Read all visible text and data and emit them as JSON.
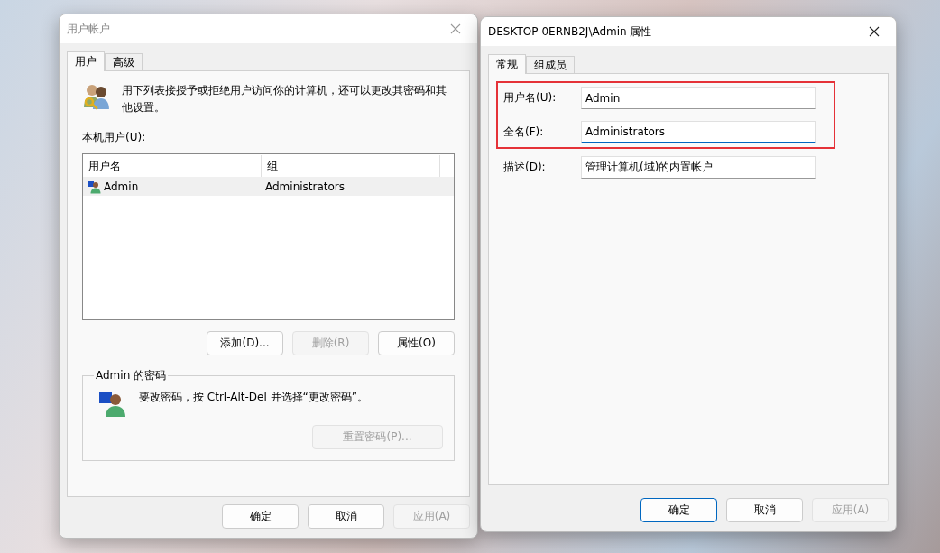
{
  "windows": [
    {
      "title": "用户帐户",
      "active": false,
      "tabs": [
        {
          "label": "用户",
          "selected": true
        },
        {
          "label": "高级",
          "selected": false
        }
      ],
      "intro": "用下列表接授予或拒绝用户访问你的计算机，还可以更改其密码和其他设置。",
      "list_label": "本机用户(U):",
      "table": {
        "columns": [
          "用户名",
          "组"
        ],
        "rows": [
          {
            "cells": [
              "Admin",
              "Administrators"
            ],
            "selected": true
          }
        ]
      },
      "list_buttons": [
        {
          "label": "添加(D)...",
          "disabled": false
        },
        {
          "label": "删除(R)",
          "disabled": true
        },
        {
          "label": "属性(O)",
          "disabled": false
        }
      ],
      "password_group": {
        "title": "Admin 的密码",
        "text": "要改密码，按 Ctrl-Alt-Del 并选择“更改密码”。",
        "button": {
          "label": "重置密码(P)...",
          "disabled": true
        }
      },
      "buttons": [
        {
          "label": "确定",
          "disabled": false,
          "default": false
        },
        {
          "label": "取消",
          "disabled": false,
          "default": false
        },
        {
          "label": "应用(A)",
          "disabled": true,
          "default": false
        }
      ]
    },
    {
      "title": "DESKTOP-0ERNB2J\\Admin 属性",
      "active": true,
      "tabs": [
        {
          "label": "常规",
          "selected": true
        },
        {
          "label": "组成员",
          "selected": false
        }
      ],
      "field_groups": [
        {
          "highlighted": true,
          "fields": [
            {
              "label": "用户名(U):",
              "value": "Admin",
              "focused": false
            },
            {
              "label": "全名(F):",
              "value": "Administrators",
              "focused": true
            }
          ]
        },
        {
          "highlighted": false,
          "fields": [
            {
              "label": "描述(D):",
              "value": "管理计算机(域)的内置帐户",
              "focused": false
            }
          ]
        }
      ],
      "buttons": [
        {
          "label": "确定",
          "disabled": false,
          "default": true
        },
        {
          "label": "取消",
          "disabled": false,
          "default": false
        },
        {
          "label": "应用(A)",
          "disabled": true,
          "default": false
        }
      ]
    }
  ]
}
